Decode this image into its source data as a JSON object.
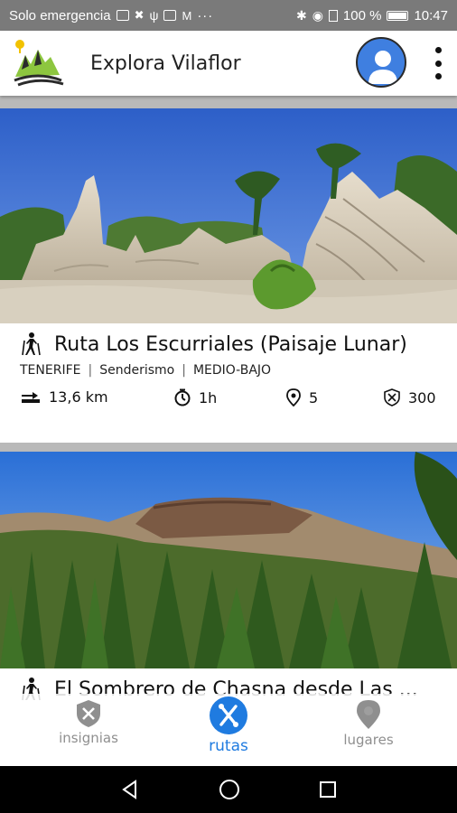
{
  "status_bar": {
    "carrier": "Solo emergencia",
    "battery": "100 %",
    "time": "10:47"
  },
  "app_bar": {
    "title": "Explora Vilaflor"
  },
  "routes": [
    {
      "title": "Ruta Los Escurriales (Paisaje Lunar)",
      "tags": [
        "TENERIFE",
        "Senderismo",
        "MEDIO-BAJO"
      ],
      "distance": "13,6 km",
      "duration": "1h",
      "places": "5",
      "points": "300"
    },
    {
      "title": "El Sombrero de Chasna desde Las ..."
    }
  ],
  "bottom_nav": {
    "items": [
      {
        "label": "insignias",
        "icon": "badge-icon",
        "active": false
      },
      {
        "label": "rutas",
        "icon": "route-icon",
        "active": true
      },
      {
        "label": "lugares",
        "icon": "place-pin-icon",
        "active": false
      }
    ]
  },
  "colors": {
    "accent": "#1f7be0",
    "avatar": "#3f7fe0",
    "logo_green": "#8dc63f"
  }
}
